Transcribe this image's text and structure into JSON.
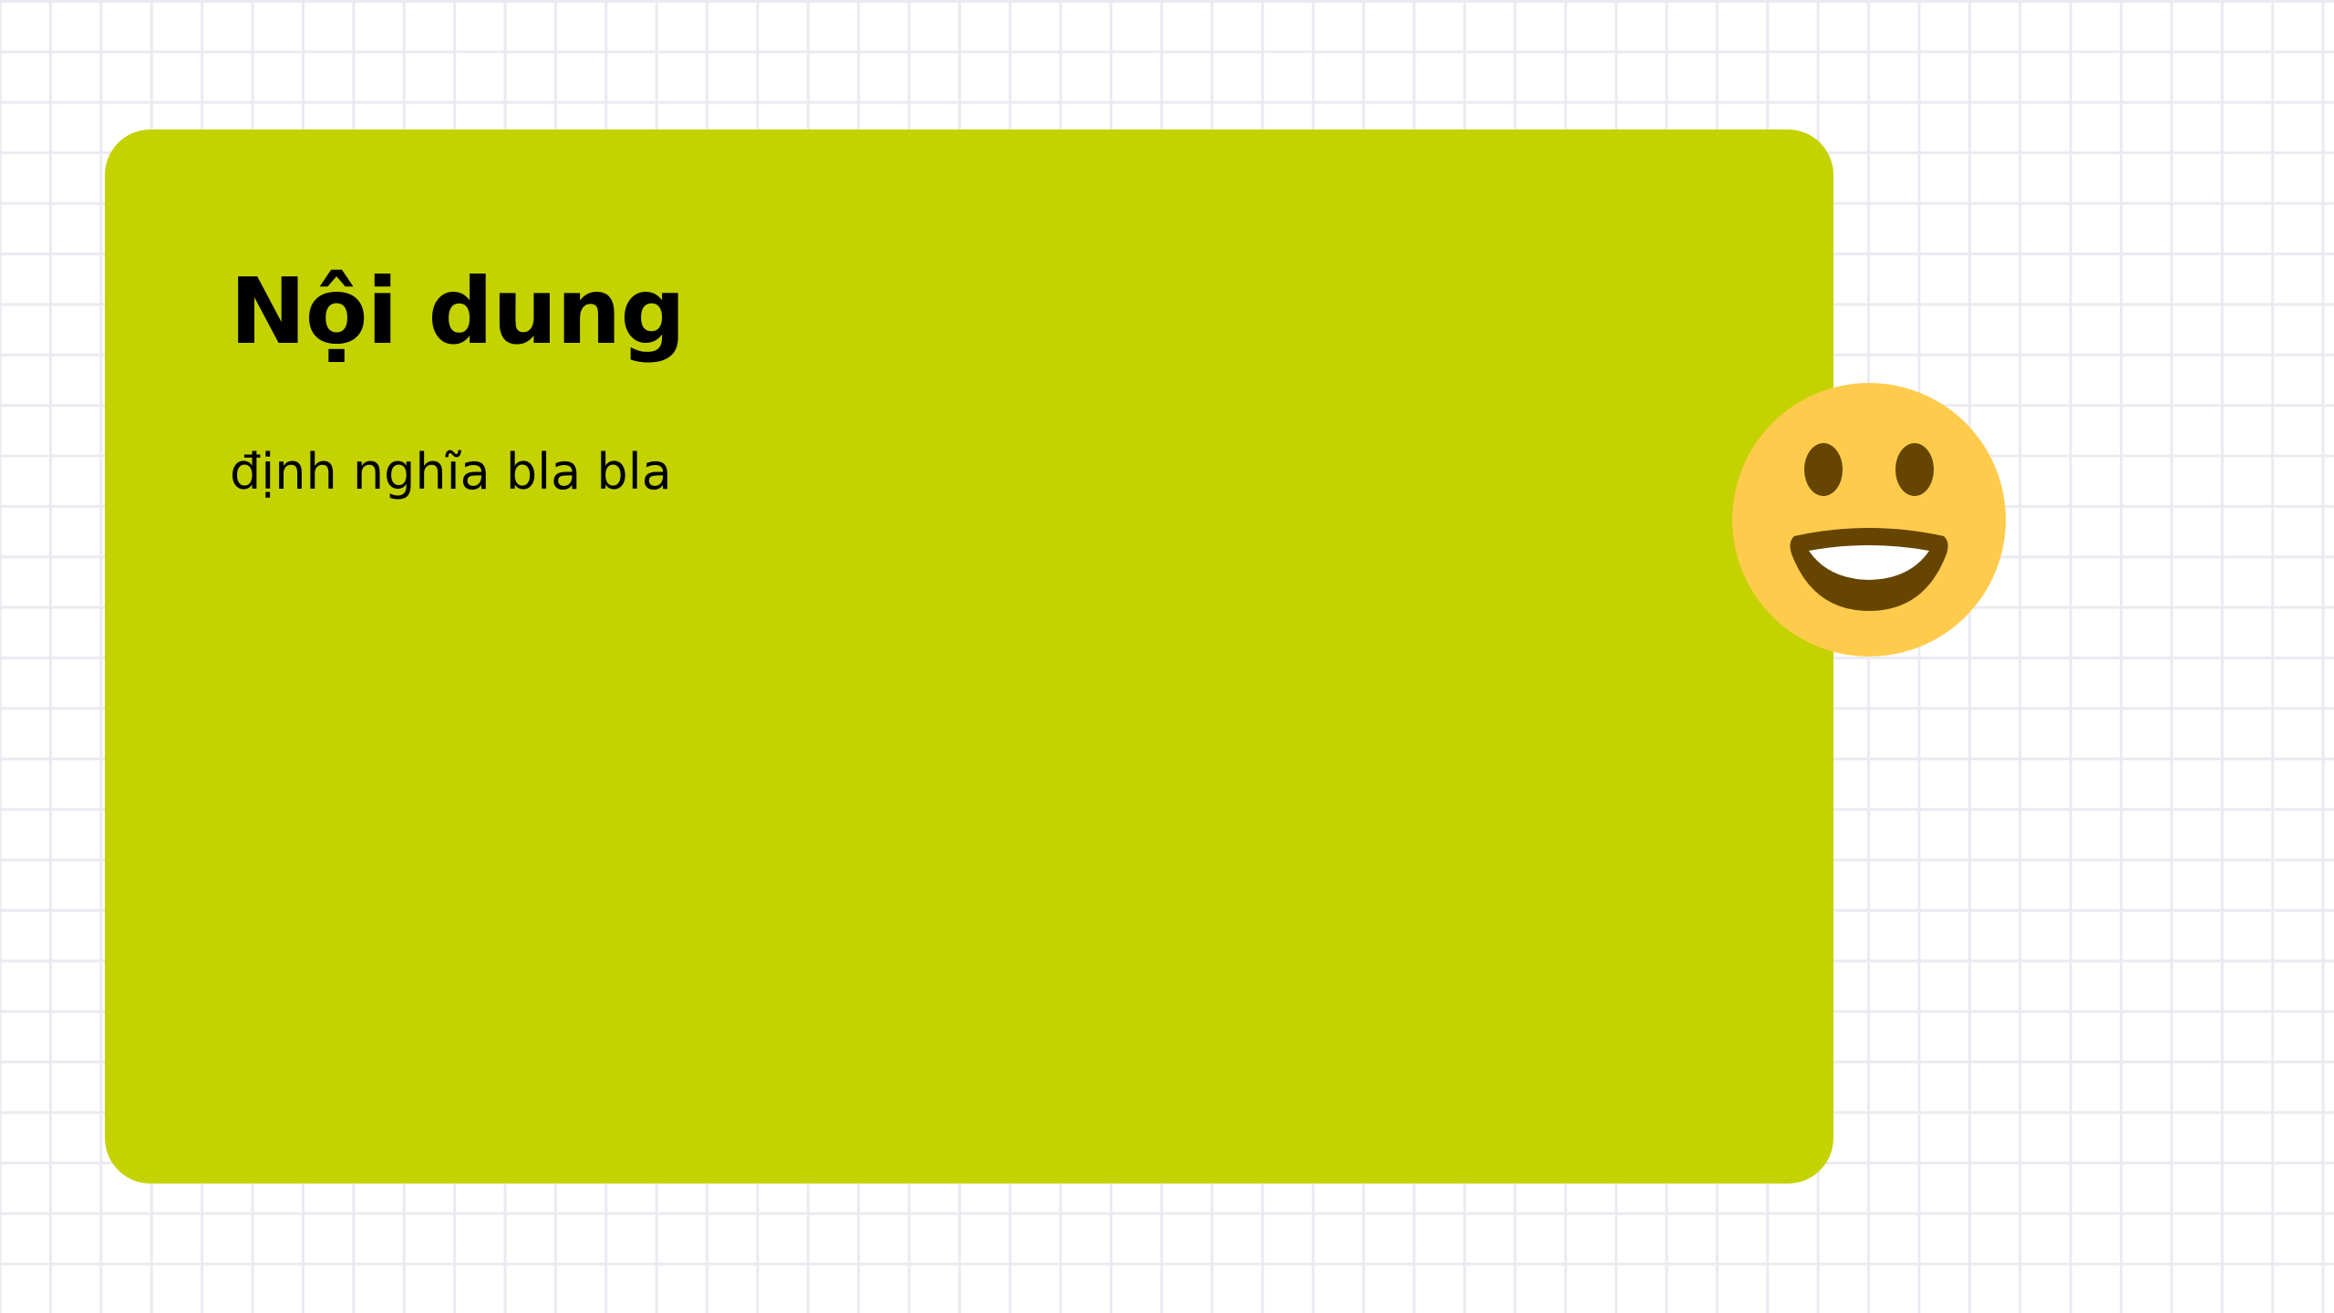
{
  "card": {
    "title": "Nội dung",
    "description": "định nghĩa bla bla",
    "background_color": "#c4d200"
  },
  "emoji": {
    "icon": "grinning-face-icon",
    "face_color": "#fecb4c",
    "feature_color": "#664500"
  }
}
